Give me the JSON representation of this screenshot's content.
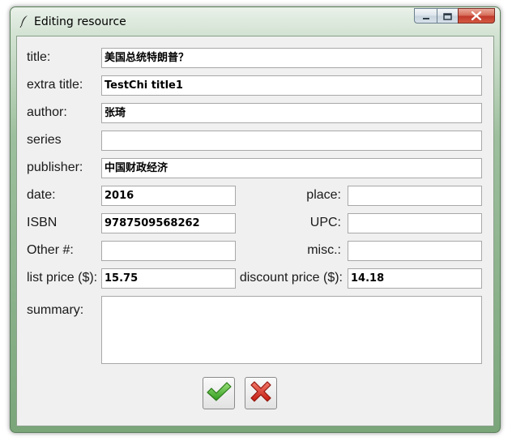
{
  "window": {
    "title": "Editing resource",
    "icon": "quill-icon",
    "controls": [
      "minimize-icon",
      "maximize-icon",
      "close-icon"
    ]
  },
  "form": {
    "title": {
      "label": "title:",
      "value": "美国总统特朗普？"
    },
    "extra_title": {
      "label": "extra title:",
      "value": "TestChi title1"
    },
    "author": {
      "label": "author:",
      "value": "张琦"
    },
    "series": {
      "label": "series",
      "value": ""
    },
    "publisher": {
      "label": "publisher:",
      "value": "中国财政经济"
    },
    "date": {
      "label": "date:",
      "value": "2016"
    },
    "place": {
      "label": "place:",
      "value": ""
    },
    "isbn": {
      "label": "ISBN",
      "value": "9787509568262"
    },
    "upc": {
      "label": "UPC:",
      "value": ""
    },
    "other_num": {
      "label": "Other #:",
      "value": ""
    },
    "misc": {
      "label": "misc.:",
      "value": ""
    },
    "list_price": {
      "label": "list price ($):",
      "value": "15.75"
    },
    "discount_price": {
      "label": "discount price ($):",
      "value": "14.18"
    },
    "summary": {
      "label": "summary:",
      "value": ""
    }
  },
  "actions": {
    "ok_icon": "checkmark-icon",
    "cancel_icon": "red-x-icon",
    "colors": {
      "ok": "#3fae2a",
      "cancel": "#d9261c"
    }
  }
}
